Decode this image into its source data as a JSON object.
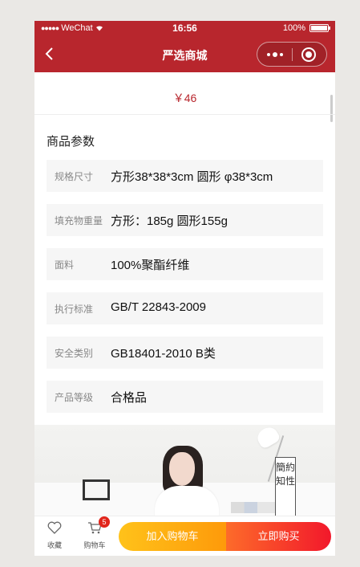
{
  "status_bar": {
    "carrier": "WeChat",
    "time": "16:56",
    "battery": "100%"
  },
  "nav": {
    "title": "严选商城"
  },
  "product": {
    "price": "￥46"
  },
  "params_section": {
    "title": "商品参数",
    "rows": [
      {
        "label": "规格尺寸",
        "value": "方形38*38*3cm 圆形 φ38*3cm"
      },
      {
        "label": "填充物重量",
        "value": "方形：185g 圆形155g"
      },
      {
        "label": "面料",
        "value": "100%聚酯纤维"
      },
      {
        "label": "执行标准",
        "value": "GB/T 22843-2009"
      },
      {
        "label": "安全类别",
        "value": "GB18401-2010 B类"
      },
      {
        "label": "产品等级",
        "value": "合格品"
      }
    ]
  },
  "banner": {
    "vertical_text": "簡約知性"
  },
  "bottom_bar": {
    "favorite_label": "收藏",
    "cart_label": "购物车",
    "cart_badge": "5",
    "add_to_cart_label": "加入购物车",
    "buy_now_label": "立即购买"
  },
  "colors": {
    "brand_red": "#b8262d",
    "price_red": "#b8262d",
    "cart_btn": "#ffc21a",
    "buy_btn": "#f2182b"
  },
  "icons": [
    "wifi-icon",
    "battery-icon",
    "back-arrow-icon",
    "more-icon",
    "close-mini-program-icon",
    "heart-icon",
    "cart-icon"
  ]
}
